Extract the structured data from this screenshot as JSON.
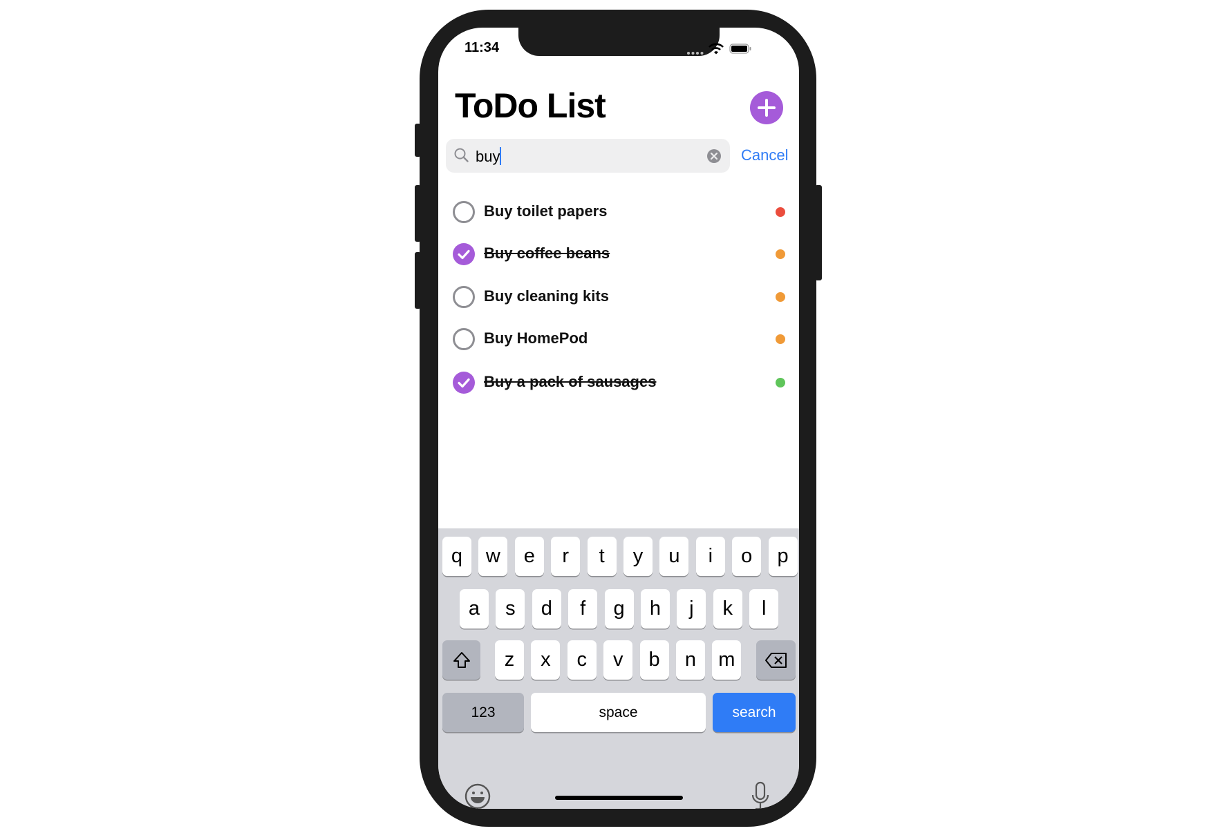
{
  "status_bar": {
    "time": "11:34"
  },
  "header": {
    "title": "ToDo List",
    "add_icon": "plus-circle-icon"
  },
  "search": {
    "value": "buy",
    "search_icon": "magnifier-icon",
    "clear_icon": "clear-x-icon",
    "cancel_label": "Cancel"
  },
  "colors": {
    "accent": "#A55BD9",
    "link": "#2F7CF6",
    "high": "#EB4D3D",
    "medium": "#F09A37",
    "low": "#5FC55A"
  },
  "todos": [
    {
      "title": "Buy toilet papers",
      "done": false,
      "priority_color": "#EB4D3D"
    },
    {
      "title": "Buy coffee beans",
      "done": true,
      "priority_color": "#F09A37"
    },
    {
      "title": "Buy cleaning kits",
      "done": false,
      "priority_color": "#F09A37"
    },
    {
      "title": "Buy HomePod",
      "done": false,
      "priority_color": "#F09A37"
    },
    {
      "title": "Buy a pack of sausages",
      "done": true,
      "priority_color": "#5FC55A"
    }
  ],
  "keyboard": {
    "row1": [
      "q",
      "w",
      "e",
      "r",
      "t",
      "y",
      "u",
      "i",
      "o",
      "p"
    ],
    "row2": [
      "a",
      "s",
      "d",
      "f",
      "g",
      "h",
      "j",
      "k",
      "l"
    ],
    "row3": [
      "z",
      "x",
      "c",
      "v",
      "b",
      "n",
      "m"
    ],
    "numbers_label": "123",
    "space_label": "space",
    "search_label": "search",
    "shift_icon": "shift-arrow-icon",
    "delete_icon": "backspace-icon",
    "emoji_icon": "emoji-smiley-icon",
    "mic_icon": "microphone-icon"
  }
}
